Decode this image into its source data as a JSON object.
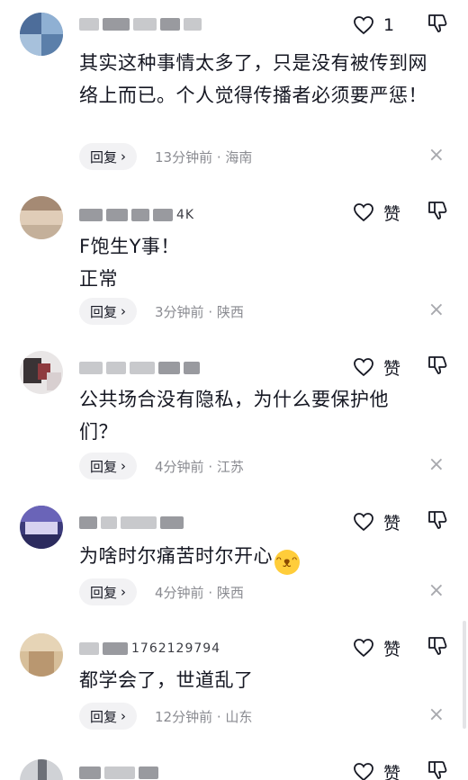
{
  "comments": [
    {
      "username_tail": "",
      "like_label": "1",
      "text": "其实这种事情太多了，只是没有被传到网络上而已。个人觉得传播者必须要严惩！",
      "reply_label": "回复",
      "time_loc": "13分钟前 · 海南"
    },
    {
      "username_tail": "4K",
      "like_label": "赞",
      "text_lines": [
        "F饱生Y事！",
        "正常"
      ],
      "reply_label": "回复",
      "time_loc": "3分钟前 · 陕西"
    },
    {
      "username_tail": "",
      "like_label": "赞",
      "text": "公共场合没有隐私，为什么要保护他们？",
      "reply_label": "回复",
      "time_loc": "4分钟前 · 江苏"
    },
    {
      "username_tail": "",
      "like_label": "赞",
      "text": "为啥时尔痛苦时尔开心",
      "reply_label": "回复",
      "time_loc": "4分钟前 · 陕西"
    },
    {
      "username_tail": "1762129794",
      "like_label": "赞",
      "text": "都学会了，世道乱了",
      "reply_label": "回复",
      "time_loc": "12分钟前 · 山东"
    },
    {
      "username_tail": "",
      "like_label": "赞"
    }
  ],
  "icons": {
    "like": "heart-outline-icon",
    "dislike": "thumbs-down-icon",
    "close": "close-icon",
    "reply_chevron": "chevron-right-icon",
    "emoji": "laughing-crying-emoji"
  },
  "colors": {
    "text": "#161823",
    "meta": "#8a8b91",
    "reply_bg": "#f2f2f4",
    "close": "#a8a9ae"
  }
}
